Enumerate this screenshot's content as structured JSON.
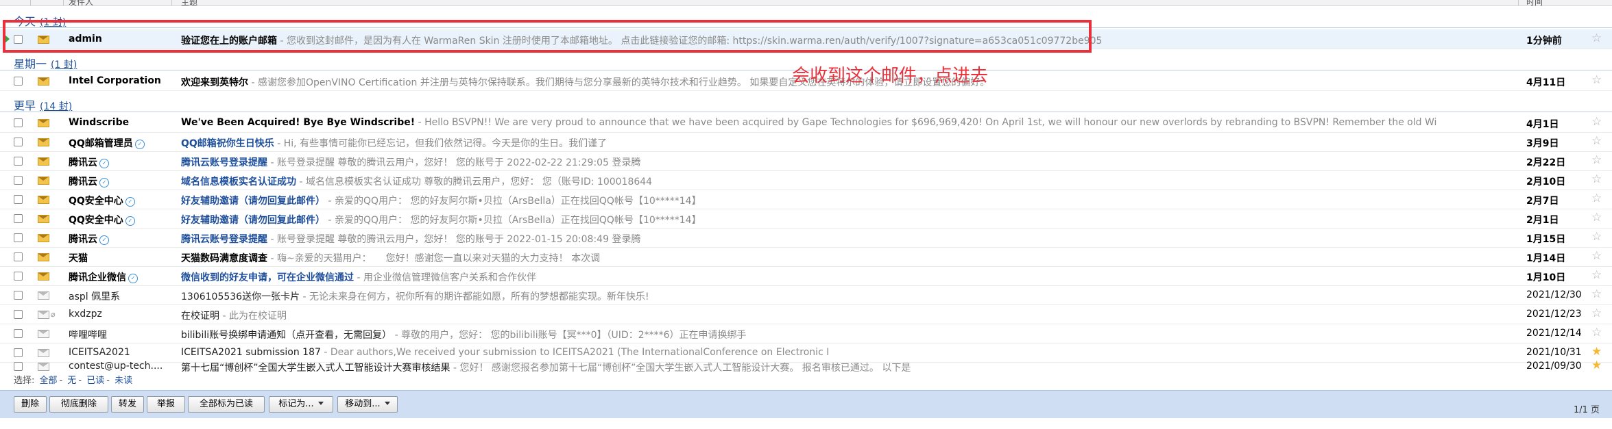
{
  "header": {
    "sender_col": "发件人",
    "subject_col": "主题",
    "time_col": "时间"
  },
  "groups": [
    {
      "title": "今天",
      "count": "(1 封)"
    },
    {
      "title": "星期一",
      "count": "(1 封)"
    },
    {
      "title": "更早",
      "count": "(14 封)"
    }
  ],
  "emails": [
    {
      "sender": "admin",
      "subject": "验证您在上的账户邮箱",
      "preview": " - 您收到这封邮件，是因为有人在 WarmaRen Skin 注册时使用了本邮箱地址。 点击此链接验证您的邮箱: https://skin.warma.ren/auth/verify/1007?signature=a653ca051c09772be905",
      "date": "1分钟前",
      "starred": false
    },
    {
      "sender": "Intel Corporation",
      "subject": "欢迎来到英特尔",
      "preview": " - 感谢您参加OpenVINO Certification 并注册与英特尔保持联系。我们期待与您分享最新的英特尔技术和行业趋势。 如果要自定义您在英特尔的体验，请立即设置您的偏好。",
      "date": "4月11日",
      "starred": false
    },
    {
      "sender": "Windscribe",
      "subject": "We've Been Acquired! Bye Bye Windscribe!",
      "preview": " - Hello BSVPN!! We are very proud to announce that we have been acquired by Gape Technologies for $696,969,420! On April 1st, we will honour our new overlords by rebranding to BSVPN! Remember the old Wi",
      "date": "4月1日",
      "starred": false
    },
    {
      "sender": "QQ邮箱管理员",
      "subject": "QQ邮箱祝你生日快乐",
      "preview": " - Hi, 有些事情可能你已经忘记，但我们依然记得。今天是你的生日。我们谨了",
      "date": "3月9日",
      "starred": false
    },
    {
      "sender": "腾讯云",
      "subject": "腾讯云账号登录提醒",
      "preview": " - 账号登录提醒 尊敬的腾讯云用户，您好！ 您的账号于 2022-02-22 21:29:05 登录腾",
      "date": "2月22日",
      "starred": false
    },
    {
      "sender": "腾讯云",
      "subject": "域名信息模板实名认证成功",
      "preview": " - 域名信息模板实名认证成功 尊敬的腾讯云用户，您好： 您（账号ID: 100018644",
      "date": "2月10日",
      "starred": false
    },
    {
      "sender": "QQ安全中心",
      "subject": "好友辅助邀请（请勿回复此邮件）",
      "preview": " - 亲爱的QQ用户： 您的好友阿尔斯•贝拉（ArsBella）正在找回QQ帐号【10*****14】",
      "date": "2月7日",
      "starred": false
    },
    {
      "sender": "QQ安全中心",
      "subject": "好友辅助邀请（请勿回复此邮件）",
      "preview": " - 亲爱的QQ用户： 您的好友阿尔斯•贝拉（ArsBella）正在找回QQ帐号【10*****14】",
      "date": "2月1日",
      "starred": false
    },
    {
      "sender": "腾讯云",
      "subject": "腾讯云账号登录提醒",
      "preview": " - 账号登录提醒 尊敬的腾讯云用户，您好！ 您的账号于 2022-01-15 20:08:49 登录腾",
      "date": "1月15日",
      "starred": false
    },
    {
      "sender": "天猫",
      "subject": "天猫数码满意度调查",
      "preview": " - 嗨~亲爱的天猫用户：　　您好！感谢您一直以来对天猫的大力支持！ 本次调",
      "date": "1月14日",
      "starred": false
    },
    {
      "sender": "腾讯企业微信",
      "subject": "微信收到的好友申请，可在企业微信通过",
      "preview": " - 用企业微信管理微信客户关系和合作伙伴",
      "date": "1月10日",
      "starred": false
    },
    {
      "sender": "aspl 佩里系",
      "subject": "1306105536送你一张卡片",
      "preview": " - 无论未来身在何方，祝你所有的期许都能如愿，所有的梦想都能实现。新年快乐!",
      "date": "2021/12/30",
      "starred": false
    },
    {
      "sender": "kxdzpz",
      "subject": "在校证明",
      "preview": " - 此为在校证明",
      "date": "2021/12/23",
      "starred": false
    },
    {
      "sender": "哔哩哔哩",
      "subject": "bilibili账号换绑申请通知（点开查看，无需回复）",
      "preview": " - 尊敬的用户，您好： 您的bilibili账号【冥***0】（UID：2****6）正在申请换绑手",
      "date": "2021/12/14",
      "starred": false
    },
    {
      "sender": "ICEITSA2021",
      "subject": "ICEITSA2021 submission 187",
      "preview": " - Dear authors,We received your submission to ICEITSA2021 (The InternationalConference on Electronic I",
      "date": "2021/10/31",
      "starred": true
    },
    {
      "sender": "contest@up-tech....",
      "subject": "第十七届“博创杯”全国大学生嵌入式人工智能设计大赛审核结果",
      "preview": " - 您好！ 感谢您报名参加第十七届“博创杯”全国大学生嵌入式人工智能设计大赛。 报名审核已通过。 以下是",
      "date": "2021/09/30",
      "starred": true
    }
  ],
  "select_bar": {
    "label": "选择:",
    "all": "全部",
    "none": "无",
    "read": "已读",
    "unread": "未读"
  },
  "toolbar": {
    "delete": "删除",
    "perm_delete": "彻底删除",
    "forward": "转发",
    "report": "举报",
    "mark_all_read": "全部标为已读",
    "mark_as": "标记为...",
    "move_to": "移动到...",
    "pager": "1/1 页"
  },
  "annotation_text": "会收到这个邮件，点进去",
  "colors": {
    "annotation": "#e8313b",
    "link": "#1e4f9c",
    "toolbar_bg": "#cfdef2"
  }
}
